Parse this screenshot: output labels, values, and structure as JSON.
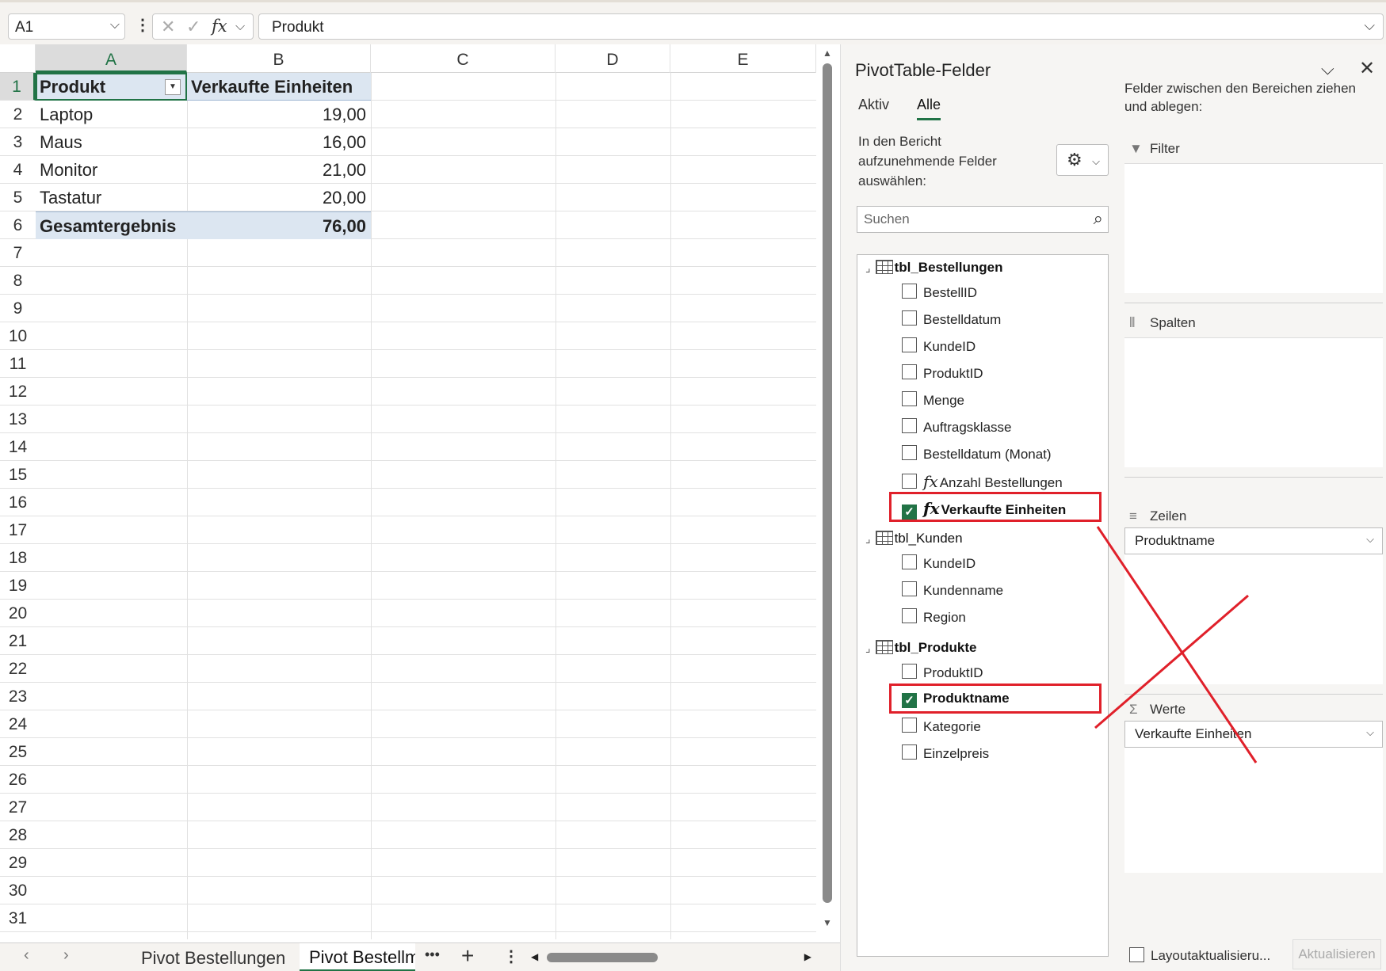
{
  "formula_bar": {
    "name_box": "A1",
    "name_box_chevron": "⌵",
    "dots": "⋮",
    "cancel_icon": "✕",
    "enter_icon": "✓",
    "fx_icon": "fx",
    "fx_chevron": "⌵",
    "content": "Produkt",
    "expand_chevron": "⌵"
  },
  "sheet": {
    "columns": [
      "A",
      "B",
      "C",
      "D",
      "E"
    ],
    "rows": [
      "1",
      "2",
      "3",
      "4",
      "5",
      "6",
      "7",
      "8",
      "9",
      "10",
      "11",
      "12",
      "13",
      "14",
      "15",
      "16",
      "17",
      "18",
      "19",
      "20",
      "21",
      "22",
      "23",
      "24",
      "25",
      "26",
      "27",
      "28",
      "29",
      "30",
      "31"
    ],
    "selected_cell": "A1",
    "pivot": {
      "header": [
        "Produkt",
        "Verkaufte Einheiten"
      ],
      "filter_icon": "filter-dropdown-icon",
      "data": [
        [
          "Laptop",
          "19,00"
        ],
        [
          "Maus",
          "16,00"
        ],
        [
          "Monitor",
          "21,00"
        ],
        [
          "Tastatur",
          "20,00"
        ]
      ],
      "total": [
        "Gesamtergebnis",
        "76,00"
      ]
    }
  },
  "tabs": {
    "prev": "‹",
    "next": "›",
    "sheet1": "Pivot Bestellungen",
    "sheet2": "Pivot Bestellm",
    "more": "•••",
    "add": "+",
    "options": "⋮"
  },
  "pane": {
    "title": "PivotTable-Felder",
    "collapse_icon": "⌵",
    "close_icon": "✕",
    "tab_active": "Aktiv",
    "tab_all": "Alle",
    "instruction": "In den Bericht aufzunehmende Felder auswählen:",
    "gear_icon": "⚙",
    "gear_chevron": "⌵",
    "search_placeholder": "Suchen",
    "search_icon": "⌕",
    "tables": [
      {
        "name": "tbl_Bestellungen",
        "fields": [
          {
            "label": "BestellID",
            "checked": false,
            "fx": false
          },
          {
            "label": "Bestelldatum",
            "checked": false,
            "fx": false
          },
          {
            "label": "KundeID",
            "checked": false,
            "fx": false
          },
          {
            "label": "ProduktID",
            "checked": false,
            "fx": false
          },
          {
            "label": "Menge",
            "checked": false,
            "fx": false
          },
          {
            "label": "Auftragsklasse",
            "checked": false,
            "fx": false
          },
          {
            "label": "Bestelldatum (Monat)",
            "checked": false,
            "fx": false
          },
          {
            "label": "Anzahl Bestellungen",
            "checked": false,
            "fx": true
          },
          {
            "label": "Verkaufte Einheiten",
            "checked": true,
            "fx": true
          }
        ]
      },
      {
        "name": "tbl_Kunden",
        "fields": [
          {
            "label": "KundeID",
            "checked": false,
            "fx": false
          },
          {
            "label": "Kundenname",
            "checked": false,
            "fx": false
          },
          {
            "label": "Region",
            "checked": false,
            "fx": false
          }
        ]
      },
      {
        "name": "tbl_Produkte",
        "fields": [
          {
            "label": "ProduktID",
            "checked": false,
            "fx": false
          },
          {
            "label": "Produktname",
            "checked": true,
            "fx": false
          },
          {
            "label": "Kategorie",
            "checked": false,
            "fx": false
          },
          {
            "label": "Einzelpreis",
            "checked": false,
            "fx": false
          }
        ]
      }
    ],
    "fx_glyph": "fx",
    "check_glyph": "✓",
    "tree_glyph": "⌟",
    "drag_hint": "Felder zwischen den Bereichen ziehen und ablegen:",
    "areas": {
      "filter": {
        "label": "Filter",
        "icon": "▼"
      },
      "columns": {
        "label": "Spalten",
        "icon": "⦀"
      },
      "rows": {
        "label": "Zeilen",
        "icon": "≡",
        "item": "Produktname"
      },
      "values": {
        "label": "Werte",
        "icon": "Σ",
        "item": "Verkaufte Einheiten"
      }
    },
    "dropdown_chevron": "⌵",
    "layout_update_label": "Layoutaktualisieru...",
    "update_button": "Aktualisieren"
  },
  "colors": {
    "accent": "#217346",
    "pivot_header_fill": "#dce6f1",
    "annotation_red": "#e0202a"
  }
}
